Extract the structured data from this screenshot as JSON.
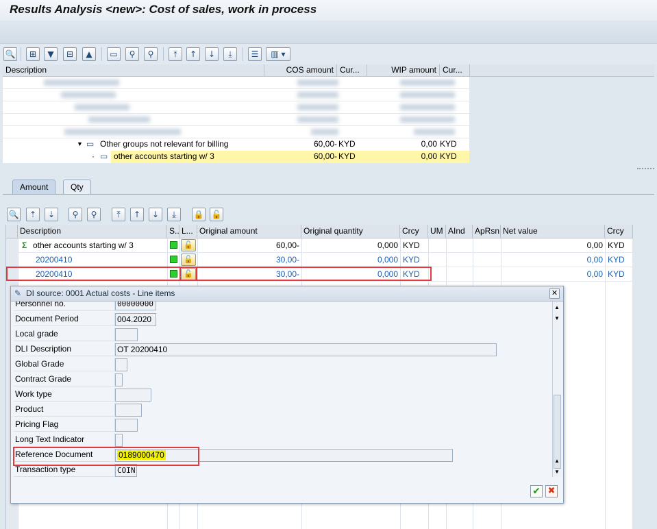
{
  "title": "Results Analysis <new>: Cost of sales, work in process",
  "upper_table": {
    "headers": [
      "Description",
      "COS amount",
      "Cur...",
      "WIP amount",
      "Cur..."
    ],
    "rows": [
      {
        "description": "Other groups not relevant for billing",
        "cos": "60,00-",
        "cur1": "KYD",
        "wip": "0,00",
        "cur2": "KYD"
      },
      {
        "description": "other accounts starting w/ 3",
        "cos": "60,00-",
        "cur1": "KYD",
        "wip": "0,00",
        "cur2": "KYD"
      }
    ]
  },
  "tabs": [
    "Amount",
    "Qty"
  ],
  "grid": {
    "headers": [
      "Description",
      "S...",
      "L...",
      "Original amount",
      "Original quantity",
      "Crcy",
      "UM",
      "AInd",
      "ApRsn",
      "Net value",
      "Crcy"
    ],
    "rows": [
      {
        "description": "other accounts starting w/ 3",
        "amount": "60,00-",
        "qty": "0,000",
        "crcy": "KYD",
        "net": "0,00",
        "crcy2": "KYD"
      },
      {
        "description": "20200410",
        "amount": "30,00-",
        "qty": "0,000",
        "crcy": "KYD",
        "net": "0,00",
        "crcy2": "KYD"
      },
      {
        "description": "20200410",
        "amount": "30,00-",
        "qty": "0,000",
        "crcy": "KYD",
        "net": "0,00",
        "crcy2": "KYD"
      }
    ]
  },
  "dialog": {
    "title": "DI source: 0001 Actual costs - Line items",
    "fields": [
      {
        "label": "Personnel no.",
        "value": "00000000"
      },
      {
        "label": "Document Period",
        "value": "004.2020"
      },
      {
        "label": "Local grade",
        "value": ""
      },
      {
        "label": "DLI Description",
        "value": "OT 20200410"
      },
      {
        "label": "Global Grade",
        "value": ""
      },
      {
        "label": "Contract Grade",
        "value": ""
      },
      {
        "label": "Work type",
        "value": ""
      },
      {
        "label": "Product",
        "value": ""
      },
      {
        "label": "Pricing Flag",
        "value": ""
      },
      {
        "label": "Long Text Indicator",
        "value": ""
      },
      {
        "label": "Reference Document",
        "value": "0189000470"
      },
      {
        "label": "Transaction type",
        "value": "COIN"
      }
    ]
  },
  "colors": {
    "highlight_row": "#fff6a8",
    "link_blue": "#1a5fb4",
    "red_box": "#e0393f",
    "marker": "#f0f000"
  }
}
